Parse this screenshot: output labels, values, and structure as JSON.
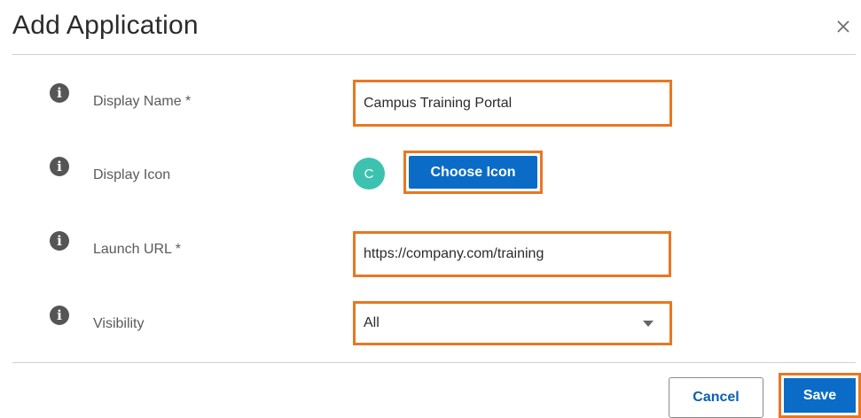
{
  "dialog": {
    "title": "Add Application",
    "close_icon": "close-icon"
  },
  "form": {
    "display_name": {
      "label": "Display Name *",
      "value": "Campus Training Portal"
    },
    "display_icon": {
      "label": "Display Icon",
      "avatar_letter": "C",
      "button_label": "Choose Icon"
    },
    "launch_url": {
      "label": "Launch URL *",
      "value": "https://company.com/training"
    },
    "visibility": {
      "label": "Visibility",
      "selected": "All"
    }
  },
  "footer": {
    "cancel_label": "Cancel",
    "save_label": "Save"
  },
  "colors": {
    "accent_blue": "#0a6cc7",
    "highlight_orange": "#e87722",
    "avatar_teal": "#3ec2b0",
    "info_icon_gray": "#555555"
  }
}
